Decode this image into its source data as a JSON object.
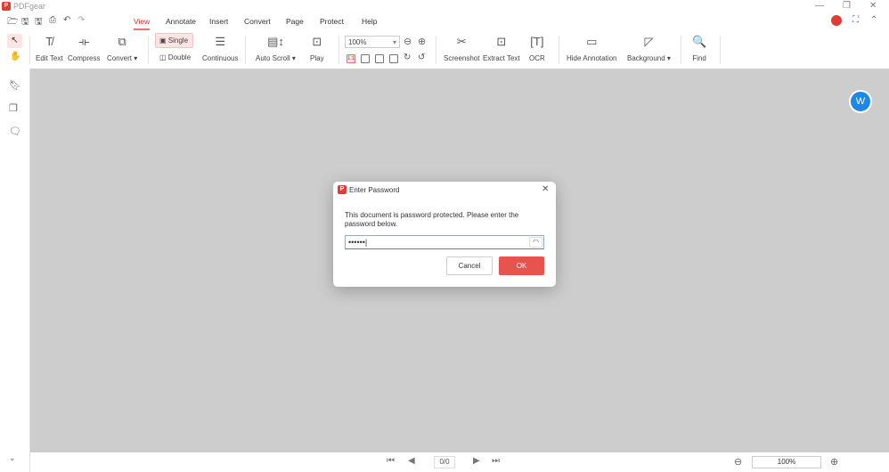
{
  "app": {
    "title": "PDFgear",
    "logo_text": "P"
  },
  "menu_tabs": [
    "View",
    "Annotate",
    "Insert",
    "Convert",
    "Page",
    "Protect",
    "Help"
  ],
  "active_tab": "View",
  "toolbar": {
    "edit_text": "Edit Text",
    "compress": "Compress",
    "convert": "Convert ▾",
    "single": "Single",
    "double": "Double",
    "continuous": "Continuous",
    "auto_scroll": "Auto Scroll ▾",
    "play": "Play",
    "zoom_value": "100%",
    "screenshot": "Screenshot",
    "extract_text": "Extract Text",
    "ocr": "OCR",
    "hide_annotation": "Hide Annotation",
    "background": "Background ▾",
    "find": "Find"
  },
  "dialog": {
    "title": "Enter Password",
    "message": "This document is password protected. Please enter the password below.",
    "password_value": "••••••",
    "cancel": "Cancel",
    "ok": "OK"
  },
  "statusbar": {
    "page": "0/0",
    "zoom": "100%"
  },
  "colors": {
    "accent": "#e53935",
    "ok_button": "#e8534f",
    "canvas": "#cdcdcd",
    "float_button": "#1e88e5"
  }
}
